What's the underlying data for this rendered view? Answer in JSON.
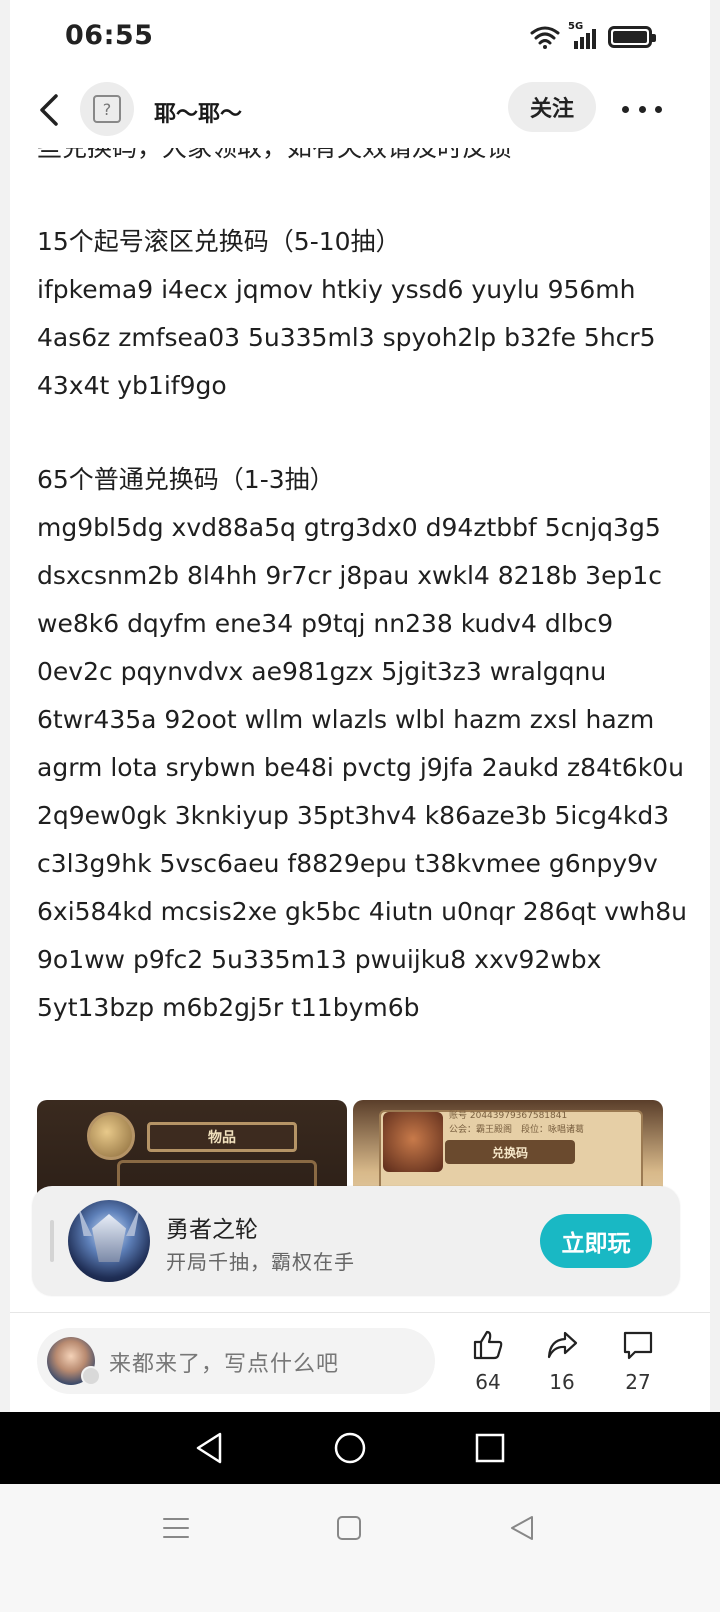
{
  "status_bar": {
    "time": "06:55",
    "network": "5G"
  },
  "header": {
    "author": "耶～耶～",
    "follow_label": "关注"
  },
  "post": {
    "cut_line": "些兑换码，大家领取，如有失效请及时反馈",
    "section1_title": "15个起号滚区兑换码（5-10抽）",
    "section1_codes": "ifpkema9 i4ecx jqmov htkiy yssd6 yuylu 956mh 4as6z zmfsea03 5u335ml3 spyoh2lp b32fe 5hcr5 43x4t yb1if9go",
    "section2_title": "65个普通兑换码（1-3抽）",
    "section2_codes": "mg9bl5dg xvd88a5q gtrg3dx0 d94ztbbf 5cnjq3g5 dsxcsnm2b 8l4hh 9r7cr j8pau xwkl4 8218b 3ep1c we8k6 dqyfm ene34 p9tqj nn238 kudv4 dlbc9 0ev2c pqynvdvx ae981gzx 5jgit3z3 wralgqnu 6twr435a 92oot wllm wlazls wlbl hazm zxsl hazm agrm lota srybwn be48i pvctg j9jfa 2aukd z84t6k0u 2q9ew0gk 3knkiyup 35pt3hv4 k86aze3b 5icg4kd3 c3l3g9hk 5vsc6aeu f8829epu t38kvmee g6npy9v 6xi584kd mcsis2xe gk5bc 4iutn u0nqr 286qt vwh8u 9o1ww p9fc2 5u335m13 pwuijku8 xxv92wbx 5yt13bzp m6b2gj5r t11bym6b"
  },
  "images": {
    "left_label": "物品",
    "right_label": "兑换码",
    "right_account": "账号 20443979367581841",
    "right_guild": "公会：霸王殿阁",
    "right_rank": "段位：咏唱诸葛"
  },
  "game_card": {
    "name": "勇者之轮",
    "slogan": "开局千抽，霸权在手",
    "play_label": "立即玩"
  },
  "bottom_bar": {
    "comment_placeholder": "来都来了，写点什么吧",
    "likes": "64",
    "shares": "16",
    "comments": "27"
  },
  "colors": {
    "accent": "#19b8c4",
    "background": "#ffffff"
  }
}
